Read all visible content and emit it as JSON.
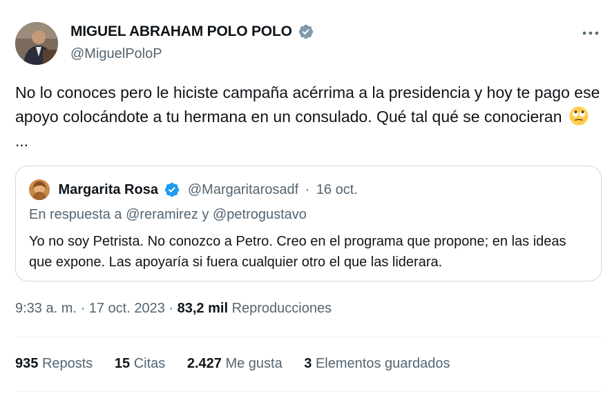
{
  "author": {
    "name": "MIGUEL ABRAHAM POLO POLO",
    "handle": "@MiguelPoloP"
  },
  "tweet": {
    "text": "No lo conoces pero le hiciste campaña acérrima a la presidencia y hoy te pago ese apoyo colocándote a tu hermana en un consulado. Qué tal qué se conocieran",
    "trailing": "...",
    "emoji": "face-with-rolling-eyes"
  },
  "quote": {
    "name": "Margarita Rosa",
    "handle": "@Margaritarosadf",
    "separator": "·",
    "date": "16 oct.",
    "reply_to": "En respuesta a @reramirez y @petrogustavo",
    "text": "Yo no soy Petrista. No conozco a Petro. Creo en el programa que propone; en las  ideas que expone.  Las apoyaría si fuera cualquier otro el que las liderara."
  },
  "meta": {
    "time": "9:33 a. m.",
    "date": "17 oct. 2023",
    "separator": "·",
    "views_count": "83,2 mil",
    "views_label": "Reproducciones"
  },
  "stats": [
    {
      "count": "935",
      "label": "Reposts"
    },
    {
      "count": "15",
      "label": "Citas"
    },
    {
      "count": "2.427",
      "label": "Me gusta"
    },
    {
      "count": "3",
      "label": "Elementos guardados"
    }
  ],
  "colors": {
    "verified_gray": "#829aab",
    "verified_blue": "#1d9bf0",
    "secondary_text": "#536471",
    "border": "#cfd9de"
  }
}
